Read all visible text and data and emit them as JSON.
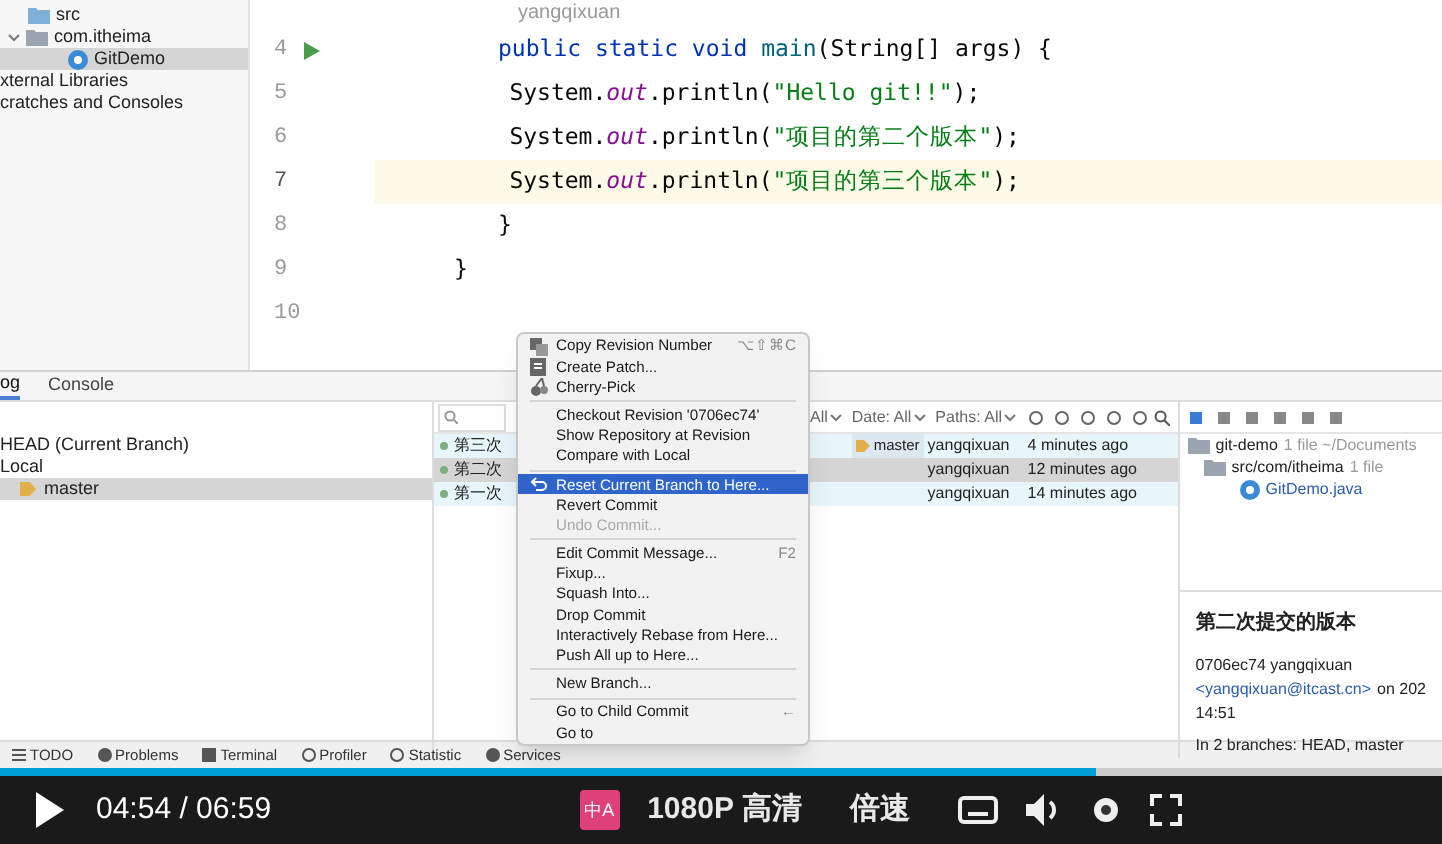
{
  "project_tree": [
    {
      "label": "src",
      "kind": "folder",
      "expanded": false,
      "selected": false
    },
    {
      "label": "com.itheima",
      "kind": "package",
      "expanded": true,
      "selected": false
    },
    {
      "label": "GitDemo",
      "kind": "class",
      "expanded": false,
      "selected": true
    },
    {
      "label": "xternal Libraries",
      "kind": "plain",
      "expanded": false,
      "selected": false
    },
    {
      "label": "cratches and Consoles",
      "kind": "plain",
      "expanded": false,
      "selected": false
    }
  ],
  "editor": {
    "author_hint": "yangqixuan",
    "lines": [
      {
        "number": "4",
        "current": false,
        "tokens": [
          {
            "kind": "keyword",
            "text": "public static void "
          },
          {
            "kind": "method",
            "text": "main"
          },
          {
            "kind": "plain",
            "text": "(String[] args) {"
          }
        ]
      },
      {
        "number": "5",
        "current": false,
        "tokens": [
          {
            "kind": "plain",
            "text": "    System."
          },
          {
            "kind": "field",
            "text": "out"
          },
          {
            "kind": "plain",
            "text": ".println("
          },
          {
            "kind": "string",
            "text": "\"Hello git!!\""
          },
          {
            "kind": "plain",
            "text": ");"
          }
        ]
      },
      {
        "number": "6",
        "current": false,
        "tokens": [
          {
            "kind": "plain",
            "text": "    System."
          },
          {
            "kind": "field",
            "text": "out"
          },
          {
            "kind": "plain",
            "text": ".println("
          },
          {
            "kind": "string",
            "text": "\"项目的第二个版本\""
          },
          {
            "kind": "plain",
            "text": ");"
          }
        ]
      },
      {
        "number": "7",
        "current": true,
        "tokens": [
          {
            "kind": "plain",
            "text": "    System."
          },
          {
            "kind": "field",
            "text": "out"
          },
          {
            "kind": "plain",
            "text": ".println("
          },
          {
            "kind": "string",
            "text": "\"项目的第三个版本\""
          },
          {
            "kind": "plain",
            "text": ");"
          }
        ]
      },
      {
        "number": "8",
        "current": false,
        "tokens": [
          {
            "kind": "plain",
            "text": "}"
          }
        ]
      },
      {
        "number": "9",
        "current": false,
        "tokens": [
          {
            "kind": "plain",
            "text": "}"
          }
        ]
      },
      {
        "number": "10",
        "current": false
      }
    ]
  },
  "log_tabs": [
    {
      "label": "og",
      "selected": true
    },
    {
      "label": "Console",
      "selected": false
    }
  ],
  "branches": [
    {
      "label": "HEAD (Current Branch)",
      "kind": "head",
      "selected": false
    },
    {
      "label": "Local",
      "kind": "group",
      "selected": false
    },
    {
      "label": "master",
      "kind": "branch",
      "selected": true
    }
  ],
  "filters": [
    "All",
    "Date: All",
    "Paths: All"
  ],
  "commits": [
    {
      "subject": "第三次",
      "tag": "master",
      "author": "yangqixuan",
      "time": "4 minutes ago",
      "selected": false
    },
    {
      "subject": "第二次",
      "author": "yangqixuan",
      "time": "12 minutes ago",
      "selected": true
    },
    {
      "subject": "第一次",
      "author": "yangqixuan",
      "time": "14 minutes ago",
      "selected": false
    }
  ],
  "changes_tree": [
    {
      "label": "git-demo",
      "meta": "1 file ~/Documents",
      "kind": "root"
    },
    {
      "label": "src/com/itheima",
      "meta": "1 file",
      "kind": "folder"
    },
    {
      "label": "GitDemo.java",
      "kind": "file"
    }
  ],
  "commit_details": {
    "title": "第二次提交的版本",
    "hash_author": "0706ec74 yangqixuan",
    "email": "<yangqixuan@itcast.cn>",
    "date": "on 202",
    "time": "14:51",
    "branches": "In 2 branches: HEAD, master"
  },
  "context_menu": [
    {
      "label": "Copy Revision Number",
      "shortcut": "⌥⇧⌘C",
      "kind": "copy"
    },
    {
      "label": "Create Patch...",
      "kind": "patch"
    },
    {
      "label": "Cherry-Pick",
      "kind": "cherry"
    },
    {
      "kind": "separator"
    },
    {
      "label": "Checkout Revision '0706ec74'",
      "kind": "item"
    },
    {
      "label": "Show Repository at Revision",
      "kind": "item"
    },
    {
      "label": "Compare with Local",
      "kind": "item"
    },
    {
      "kind": "separator"
    },
    {
      "label": "Reset Current Branch to Here...",
      "kind": "selected"
    },
    {
      "label": "Revert Commit",
      "kind": "item"
    },
    {
      "label": "Undo Commit...",
      "kind": "disabled"
    },
    {
      "kind": "separator"
    },
    {
      "label": "Edit Commit Message...",
      "shortcut": "F2",
      "kind": "item"
    },
    {
      "label": "Fixup...",
      "kind": "item"
    },
    {
      "label": "Squash Into...",
      "kind": "item"
    },
    {
      "label": "Drop Commit",
      "kind": "item"
    },
    {
      "label": "Interactively Rebase from Here...",
      "kind": "item"
    },
    {
      "label": "Push All up to Here...",
      "kind": "item"
    },
    {
      "kind": "separator"
    },
    {
      "label": "New Branch...",
      "kind": "item"
    },
    {
      "kind": "separator"
    },
    {
      "label": "Go to Child Commit",
      "shortcut": "←",
      "kind": "item"
    },
    {
      "label": "Go to",
      "kind": "item"
    }
  ],
  "tool_windows": [
    {
      "label": "TODO",
      "kind": "todo"
    },
    {
      "label": "Problems",
      "kind": "problems"
    },
    {
      "label": "Terminal",
      "kind": "terminal"
    },
    {
      "label": "Profiler",
      "kind": "profiler"
    },
    {
      "label": "Statistic",
      "kind": "statistic"
    },
    {
      "label": "Services",
      "kind": "services"
    }
  ],
  "player": {
    "level": 0.76,
    "time": "04:54 / 06:59",
    "subtitle_badge": "中A",
    "quality": "1080P 高清",
    "speed": "倍速"
  }
}
